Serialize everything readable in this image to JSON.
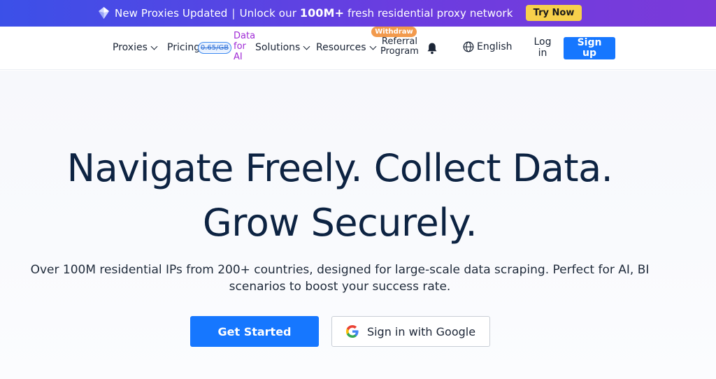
{
  "promo": {
    "text_start": "New Proxies Updated",
    "separator": "|",
    "text_mid": "Unlock our",
    "highlight": "100M+",
    "text_end": "fresh residential proxy network",
    "cta": "Try Now"
  },
  "nav": {
    "items": [
      {
        "label": "Proxies"
      },
      {
        "label": "Pricing"
      },
      {
        "label": "Solutions"
      },
      {
        "label": "Resources"
      }
    ],
    "price_badge": "0.65/GB",
    "ai_link": "Data for AI",
    "ai_link_lines": [
      "Data",
      "for",
      "AI"
    ],
    "referral_badge": "Withdraw",
    "referral_lines": [
      "Referral",
      "Program"
    ],
    "language": "English",
    "login_lines": [
      "Log",
      "in"
    ],
    "signup_lines": [
      "Sign",
      "up"
    ]
  },
  "hero": {
    "headline_line1": "Navigate Freely. Collect Data.",
    "headline_line2": "Grow Securely.",
    "subtitle_line1": "Over 100M residential IPs from 200+ countries, designed for large-scale data scraping. Perfect for AI, BI",
    "subtitle_line2": "scenarios to boost your success rate.",
    "primary_cta": "Get Started",
    "google_cta": "Sign in with Google"
  },
  "colors": {
    "accent": "#1677ff",
    "promo_gradient_start": "#3b50e8",
    "promo_gradient_end": "#7b3ad9",
    "try_button": "#f7d04b",
    "ai_link": "#a02bd6",
    "withdraw_badge": "#f29a4d",
    "headline": "#0d2342"
  },
  "icons": [
    "diamond-icon",
    "chevron-down-icon",
    "bell-icon",
    "globe-icon",
    "google-icon"
  ]
}
